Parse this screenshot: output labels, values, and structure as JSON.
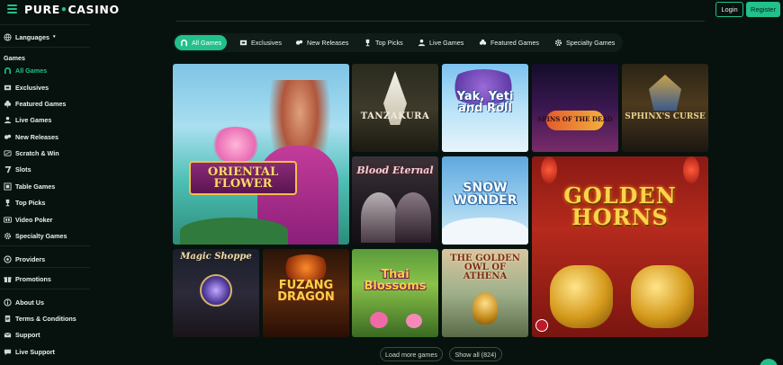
{
  "header": {
    "logo_left": "PURE",
    "logo_right": "CASINO",
    "login": "Login",
    "register": "Register"
  },
  "sidebar": {
    "languages": "Languages",
    "games_heading": "Games",
    "games": [
      {
        "label": "All Games",
        "icon": "horseshoe-icon",
        "active": true
      },
      {
        "label": "Exclusives",
        "icon": "exclusive-icon"
      },
      {
        "label": "Featured Games",
        "icon": "clover-icon"
      },
      {
        "label": "Live Games",
        "icon": "dealer-icon"
      },
      {
        "label": "New Releases",
        "icon": "new-icon"
      },
      {
        "label": "Scratch & Win",
        "icon": "scratch-icon"
      },
      {
        "label": "Slots",
        "icon": "slot-icon"
      },
      {
        "label": "Table Games",
        "icon": "table-icon"
      },
      {
        "label": "Top Picks",
        "icon": "trophy-icon"
      },
      {
        "label": "Video Poker",
        "icon": "cards-icon"
      },
      {
        "label": "Specialty Games",
        "icon": "gear-icon"
      }
    ],
    "providers": "Providers",
    "promotions": "Promotions",
    "about": "About Us",
    "terms": "Terms & Conditions",
    "support": "Support",
    "live_support": "Live Support"
  },
  "tabs": [
    {
      "label": "All Games",
      "icon": "horseshoe-icon",
      "active": true
    },
    {
      "label": "Exclusives",
      "icon": "exclusive-icon"
    },
    {
      "label": "New Releases",
      "icon": "new-icon"
    },
    {
      "label": "Top Picks",
      "icon": "trophy-icon"
    },
    {
      "label": "Live Games",
      "icon": "dealer-icon"
    },
    {
      "label": "Featured Games",
      "icon": "clover-icon"
    },
    {
      "label": "Specialty Games",
      "icon": "gear-icon"
    }
  ],
  "games": {
    "oriental_flower": "ORIENTAL FLOWER",
    "tanzakura": "TANZAKURA",
    "yak_yeti_roll": "Yak, Yeti and Roll",
    "spinfinity": "SPINS OF THE DEAD",
    "sphinxs_curse": "SPHINX'S CURSE",
    "blood_eternal": "Blood Eternal",
    "snow_wonder": "SNOW WONDER",
    "golden_horns": "GOLDEN HORNS",
    "magic_shoppe": "Magic Shoppe",
    "fuzang_dragon": "FUZANG DRAGON",
    "thai_blossoms": "Thai Blossoms",
    "golden_owl": "THE GOLDEN OWL OF ATHENA"
  },
  "footer": {
    "load_more": "Load more games",
    "show_all": "Show all (824)"
  },
  "colors": {
    "accent": "#22c08a",
    "background": "#07120e"
  }
}
